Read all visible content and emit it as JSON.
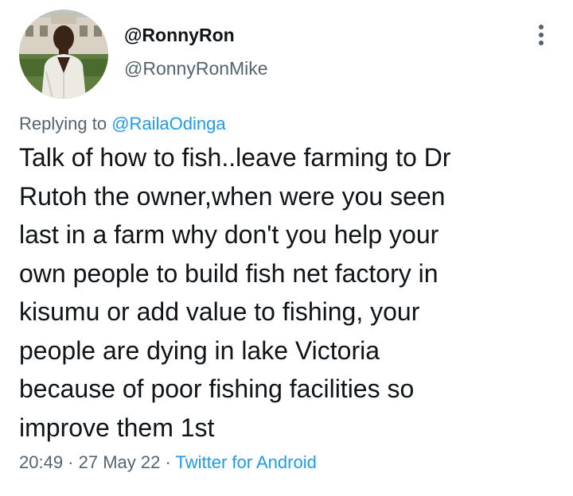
{
  "author": {
    "display_name": "@RonnyRon",
    "handle": "@RonnyRonMike",
    "avatar_icon": "user-avatar-photo"
  },
  "reply": {
    "prefix": "Replying to ",
    "mention": "@RailaOdinga"
  },
  "tweet": {
    "lines": [
      "Talk of how to fish..leave farming to Dr",
      "Rutoh the owner,when were you seen",
      "last in a farm why don't you help your",
      "own people to build fish net factory in",
      "kisumu or add value to fishing, your",
      "people are dying in lake Victoria",
      "because of poor fishing facilities so",
      "improve them 1st"
    ]
  },
  "meta": {
    "time": "20:49",
    "separator": " · ",
    "date": "27 May 22",
    "source": "Twitter for Android"
  },
  "icons": {
    "more": "more-vertical-icon"
  },
  "colors": {
    "text": "#0f1419",
    "secondary": "#536471",
    "link": "#1d9bf0"
  }
}
